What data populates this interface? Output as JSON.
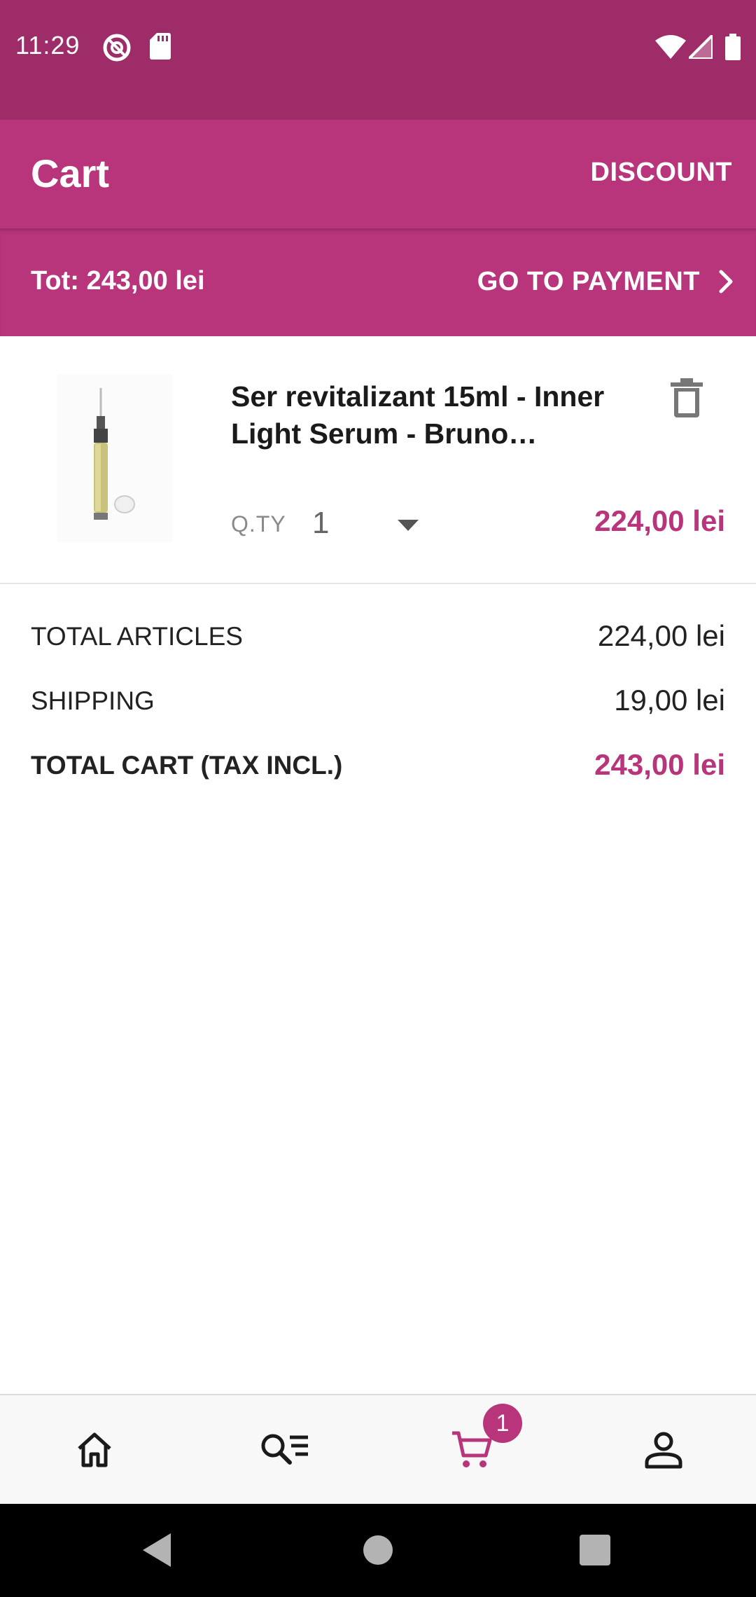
{
  "status_bar": {
    "time": "11:29",
    "icons": [
      "no-disturb-icon",
      "sd-card-icon",
      "wifi-icon",
      "signal-icon",
      "battery-icon"
    ]
  },
  "app_bar": {
    "title": "Cart",
    "discount_label": "DISCOUNT"
  },
  "payment_bar": {
    "total": "Tot: 243,00 lei",
    "go_to_payment_label": "GO TO PAYMENT"
  },
  "cart_item": {
    "name": "Ser revitalizant 15ml - Inner Light Serum - Bruno…",
    "qty_label": "Q.TY",
    "qty_value": "1",
    "price": "224,00 lei"
  },
  "summary": {
    "total_articles_label": "TOTAL ARTICLES",
    "total_articles_value": "224,00 lei",
    "shipping_label": "SHIPPING",
    "shipping_value": "19,00 lei",
    "total_cart_label": "TOTAL CART (TAX INCL.)",
    "total_cart_value": "243,00 lei"
  },
  "bottom_nav": {
    "items": [
      "home-icon",
      "search-list-icon",
      "cart-icon",
      "account-icon"
    ],
    "cart_badge": "1",
    "active_item": "cart"
  },
  "colors": {
    "status_bar": "#9e2c68",
    "primary": "#b8357b",
    "text": "#222222"
  }
}
